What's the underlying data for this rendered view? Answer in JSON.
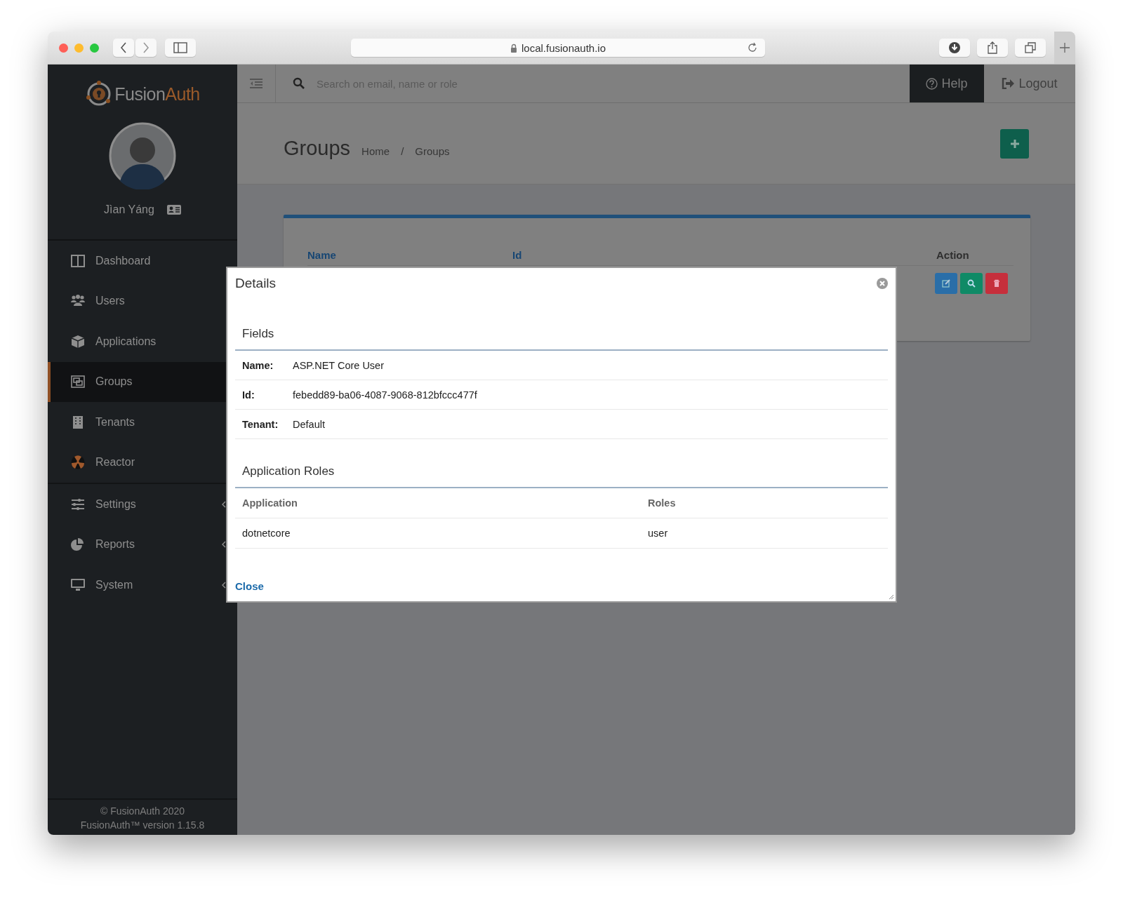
{
  "browser": {
    "url": "local.fusionauth.io"
  },
  "logo": {
    "part_1": "Fusion",
    "part_2": "Auth"
  },
  "user": {
    "name": "Jìan Yáng"
  },
  "sidebar": {
    "items": [
      {
        "label": "Dashboard",
        "selected": false,
        "expandable": false
      },
      {
        "label": "Users",
        "selected": false,
        "expandable": false
      },
      {
        "label": "Applications",
        "selected": false,
        "expandable": false
      },
      {
        "label": "Groups",
        "selected": true,
        "expandable": false
      },
      {
        "label": "Tenants",
        "selected": false,
        "expandable": false
      },
      {
        "label": "Reactor",
        "selected": false,
        "expandable": false
      },
      {
        "label": "Settings",
        "selected": false,
        "expandable": true
      },
      {
        "label": "Reports",
        "selected": false,
        "expandable": true
      },
      {
        "label": "System",
        "selected": false,
        "expandable": true
      }
    ]
  },
  "footer": {
    "copyright": "© FusionAuth 2020",
    "version": "FusionAuth™ version 1.15.8"
  },
  "topbar": {
    "search": {
      "placeholder": "Search on email, name or role"
    },
    "help": "Help",
    "logout": "Logout"
  },
  "page": {
    "title": "Groups",
    "breadcrumbs": [
      "Home",
      "Groups"
    ],
    "breadcrumb_separator": "/"
  },
  "table": {
    "columns": [
      "Name",
      "Id",
      "Action"
    ],
    "row_actions": [
      {
        "kind": "edit"
      },
      {
        "kind": "view"
      },
      {
        "kind": "delete"
      }
    ]
  },
  "modal": {
    "title": "Details",
    "fields_heading": "Fields",
    "fields": [
      {
        "label": "Name:",
        "value": "ASP.NET Core User"
      },
      {
        "label": "Id:",
        "value": "febedd89-ba06-4087-9068-812bfccc477f"
      },
      {
        "label": "Tenant:",
        "value": "Default"
      }
    ],
    "roles_heading": "Application Roles",
    "roles_columns": [
      "Application",
      "Roles"
    ],
    "roles_rows": [
      {
        "application": "dotnetcore",
        "roles": "user"
      }
    ],
    "close": "Close"
  }
}
